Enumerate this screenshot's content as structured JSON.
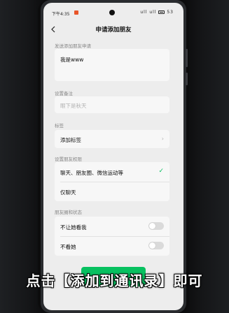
{
  "status_bar": {
    "time": "下午4:35",
    "signal_text": "ull ull",
    "battery": "53"
  },
  "nav": {
    "title": "申请添加朋友"
  },
  "request_message": {
    "label": "发送添加朋友申请",
    "value": "我是www"
  },
  "remark": {
    "label": "设置备注",
    "placeholder": "眼下是秋天"
  },
  "tags": {
    "label": "标签",
    "item_label": "添加标签"
  },
  "permissions": {
    "label": "设置朋友权限",
    "options": [
      {
        "label": "聊天、朋友圈、微信运动等",
        "selected": true
      },
      {
        "label": "仅聊天",
        "selected": false
      }
    ]
  },
  "moments": {
    "label": "朋友圈和状态",
    "toggles": [
      {
        "label": "不让她看我",
        "on": false
      },
      {
        "label": "不看她",
        "on": false
      }
    ]
  },
  "accent_color": "#07c160",
  "caption": "点击【添加到通讯录】即可"
}
